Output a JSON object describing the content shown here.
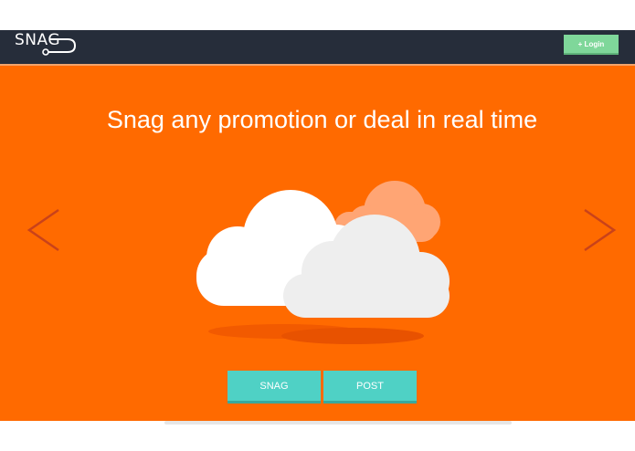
{
  "navbar": {
    "logo_text": "SNAG",
    "login_label": "+ Login"
  },
  "hero": {
    "headline": "Snag any promotion or deal in real time",
    "prev_arrow": "<",
    "next_arrow": ">"
  },
  "actions": {
    "snag_label": "SNAG",
    "post_label": "POST"
  },
  "colors": {
    "navbar_bg": "#262d3a",
    "hero_bg": "#ff6a00",
    "login_btn": "#7fd79a",
    "action_btn": "#4fd1c5",
    "arrow": "#c9421a"
  },
  "icons": {
    "logo_hook": "hook-icon",
    "prev": "chevron-left-icon",
    "next": "chevron-right-icon",
    "illustration": "cloud-illustration"
  }
}
